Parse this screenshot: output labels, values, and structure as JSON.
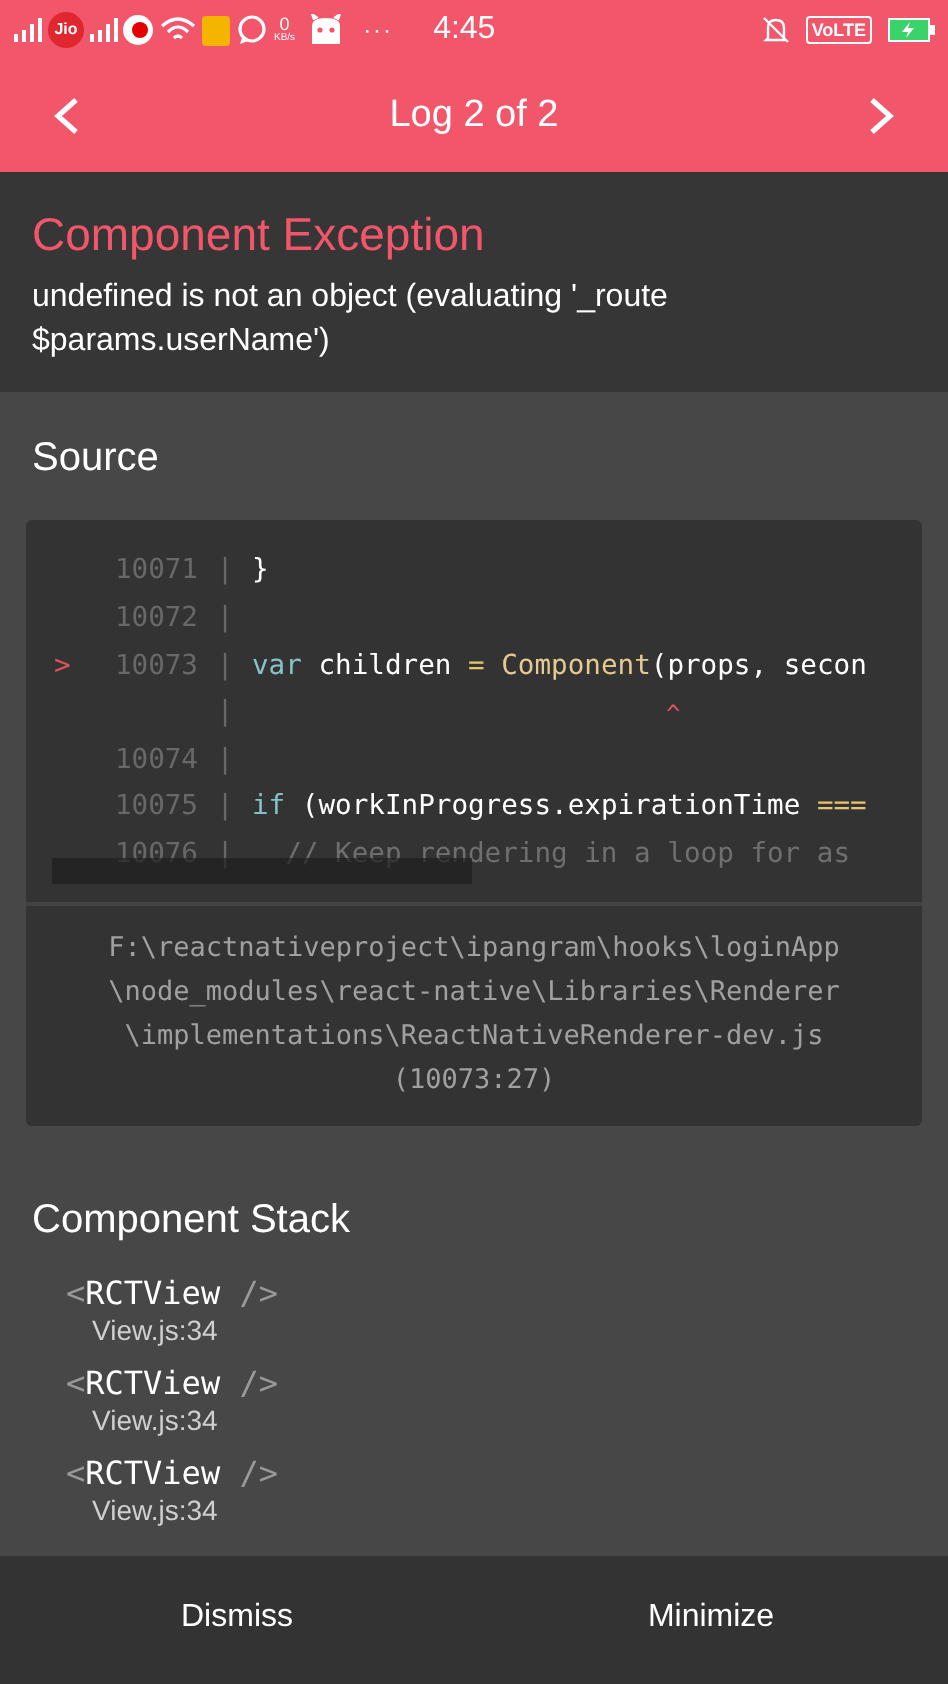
{
  "status_bar": {
    "carrier": "Jio",
    "speed_value": "0",
    "speed_unit": "KB/s",
    "overflow": "···",
    "time": "4:45",
    "network_badge": "VoLTE"
  },
  "header": {
    "title": "Log 2 of 2"
  },
  "exception": {
    "title": "Component Exception",
    "message": "undefined is not an object (evaluating '_route $params.userName')"
  },
  "source": {
    "heading": "Source",
    "lines": [
      {
        "number": "10071",
        "tokens": [
          {
            "kind": "plain",
            "text": "}"
          }
        ]
      },
      {
        "number": "10072"
      },
      {
        "number": "10073",
        "pointer_mark": ">",
        "tokens": [
          {
            "kind": "keyword",
            "text": "var"
          },
          {
            "kind": "plain",
            "text": " children "
          },
          {
            "kind": "operator",
            "text": "= "
          },
          {
            "kind": "function",
            "text": "Component"
          },
          {
            "kind": "plain",
            "text": "(props, secon"
          }
        ]
      },
      {
        "caret": "^"
      },
      {
        "number": "10074"
      },
      {
        "number": "10075",
        "tokens": [
          {
            "kind": "keyword",
            "text": "if"
          },
          {
            "kind": "plain",
            "text": " (workInProgress.expirationTime "
          },
          {
            "kind": "operator",
            "text": "==="
          }
        ]
      },
      {
        "number": "10076",
        "tokens": [
          {
            "kind": "comment",
            "text": "  // Keep rendering in a loop for as"
          }
        ]
      }
    ],
    "separator": "|",
    "file_path": "F:\\reactnativeproject\\ipangram\\hooks\\loginApp \\node_modules\\react-native\\Libraries\\Renderer \\implementations\\ReactNativeRenderer-dev.js (10073:27)"
  },
  "component_stack": {
    "heading": "Component Stack",
    "items": [
      {
        "open": "<",
        "name": "RCTView",
        "close": "/>",
        "file": "View.js:34"
      },
      {
        "open": "<",
        "name": "RCTView",
        "close": "/>",
        "file": "View.js:34"
      },
      {
        "open": "<",
        "name": "RCTView",
        "close": "/>",
        "file": "View.js:34"
      }
    ]
  },
  "buttons": [
    {
      "label": "Dismiss"
    },
    {
      "label": "Minimize"
    }
  ]
}
